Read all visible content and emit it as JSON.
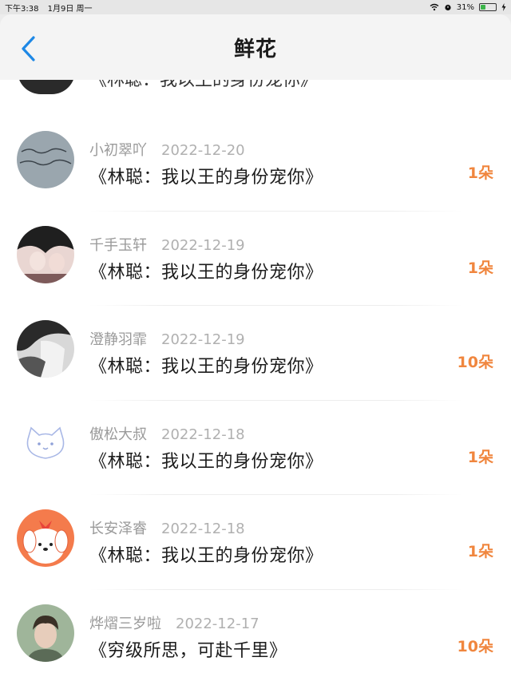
{
  "status_bar": {
    "time": "下午3:38",
    "date": "1月9日 周一",
    "battery_percent": "31%",
    "battery_level": 0.31,
    "icons": [
      "wifi-icon",
      "alarm-icon",
      "battery-icon",
      "charging-icon"
    ]
  },
  "nav": {
    "title": "鲜花",
    "back_icon": "chevron-left-icon",
    "accent": "#1e88e5"
  },
  "partial_row": {
    "message": "《林聪：我以王的身份宠你》"
  },
  "items": [
    {
      "username": "小初翠吖",
      "date": "2022-12-20",
      "message": "《林聪：我以王的身份宠你》",
      "count": "1朵"
    },
    {
      "username": "千手玉轩",
      "date": "2022-12-19",
      "message": "《林聪：我以王的身份宠你》",
      "count": "1朵"
    },
    {
      "username": "澄静羽霏",
      "date": "2022-12-19",
      "message": "《林聪：我以王的身份宠你》",
      "count": "10朵"
    },
    {
      "username": "傲松大叔",
      "date": "2022-12-18",
      "message": "《林聪：我以王的身份宠你》",
      "count": "1朵"
    },
    {
      "username": "长安泽睿",
      "date": "2022-12-18",
      "message": "《林聪：我以王的身份宠你》",
      "count": "1朵"
    },
    {
      "username": "烨熠三岁啦",
      "date": "2022-12-17",
      "message": "《穷级所思，可赴千里》",
      "count": "10朵"
    }
  ],
  "colors": {
    "count": "#f0863e",
    "username": "#9a9a9a",
    "date": "#b0b0b0"
  }
}
